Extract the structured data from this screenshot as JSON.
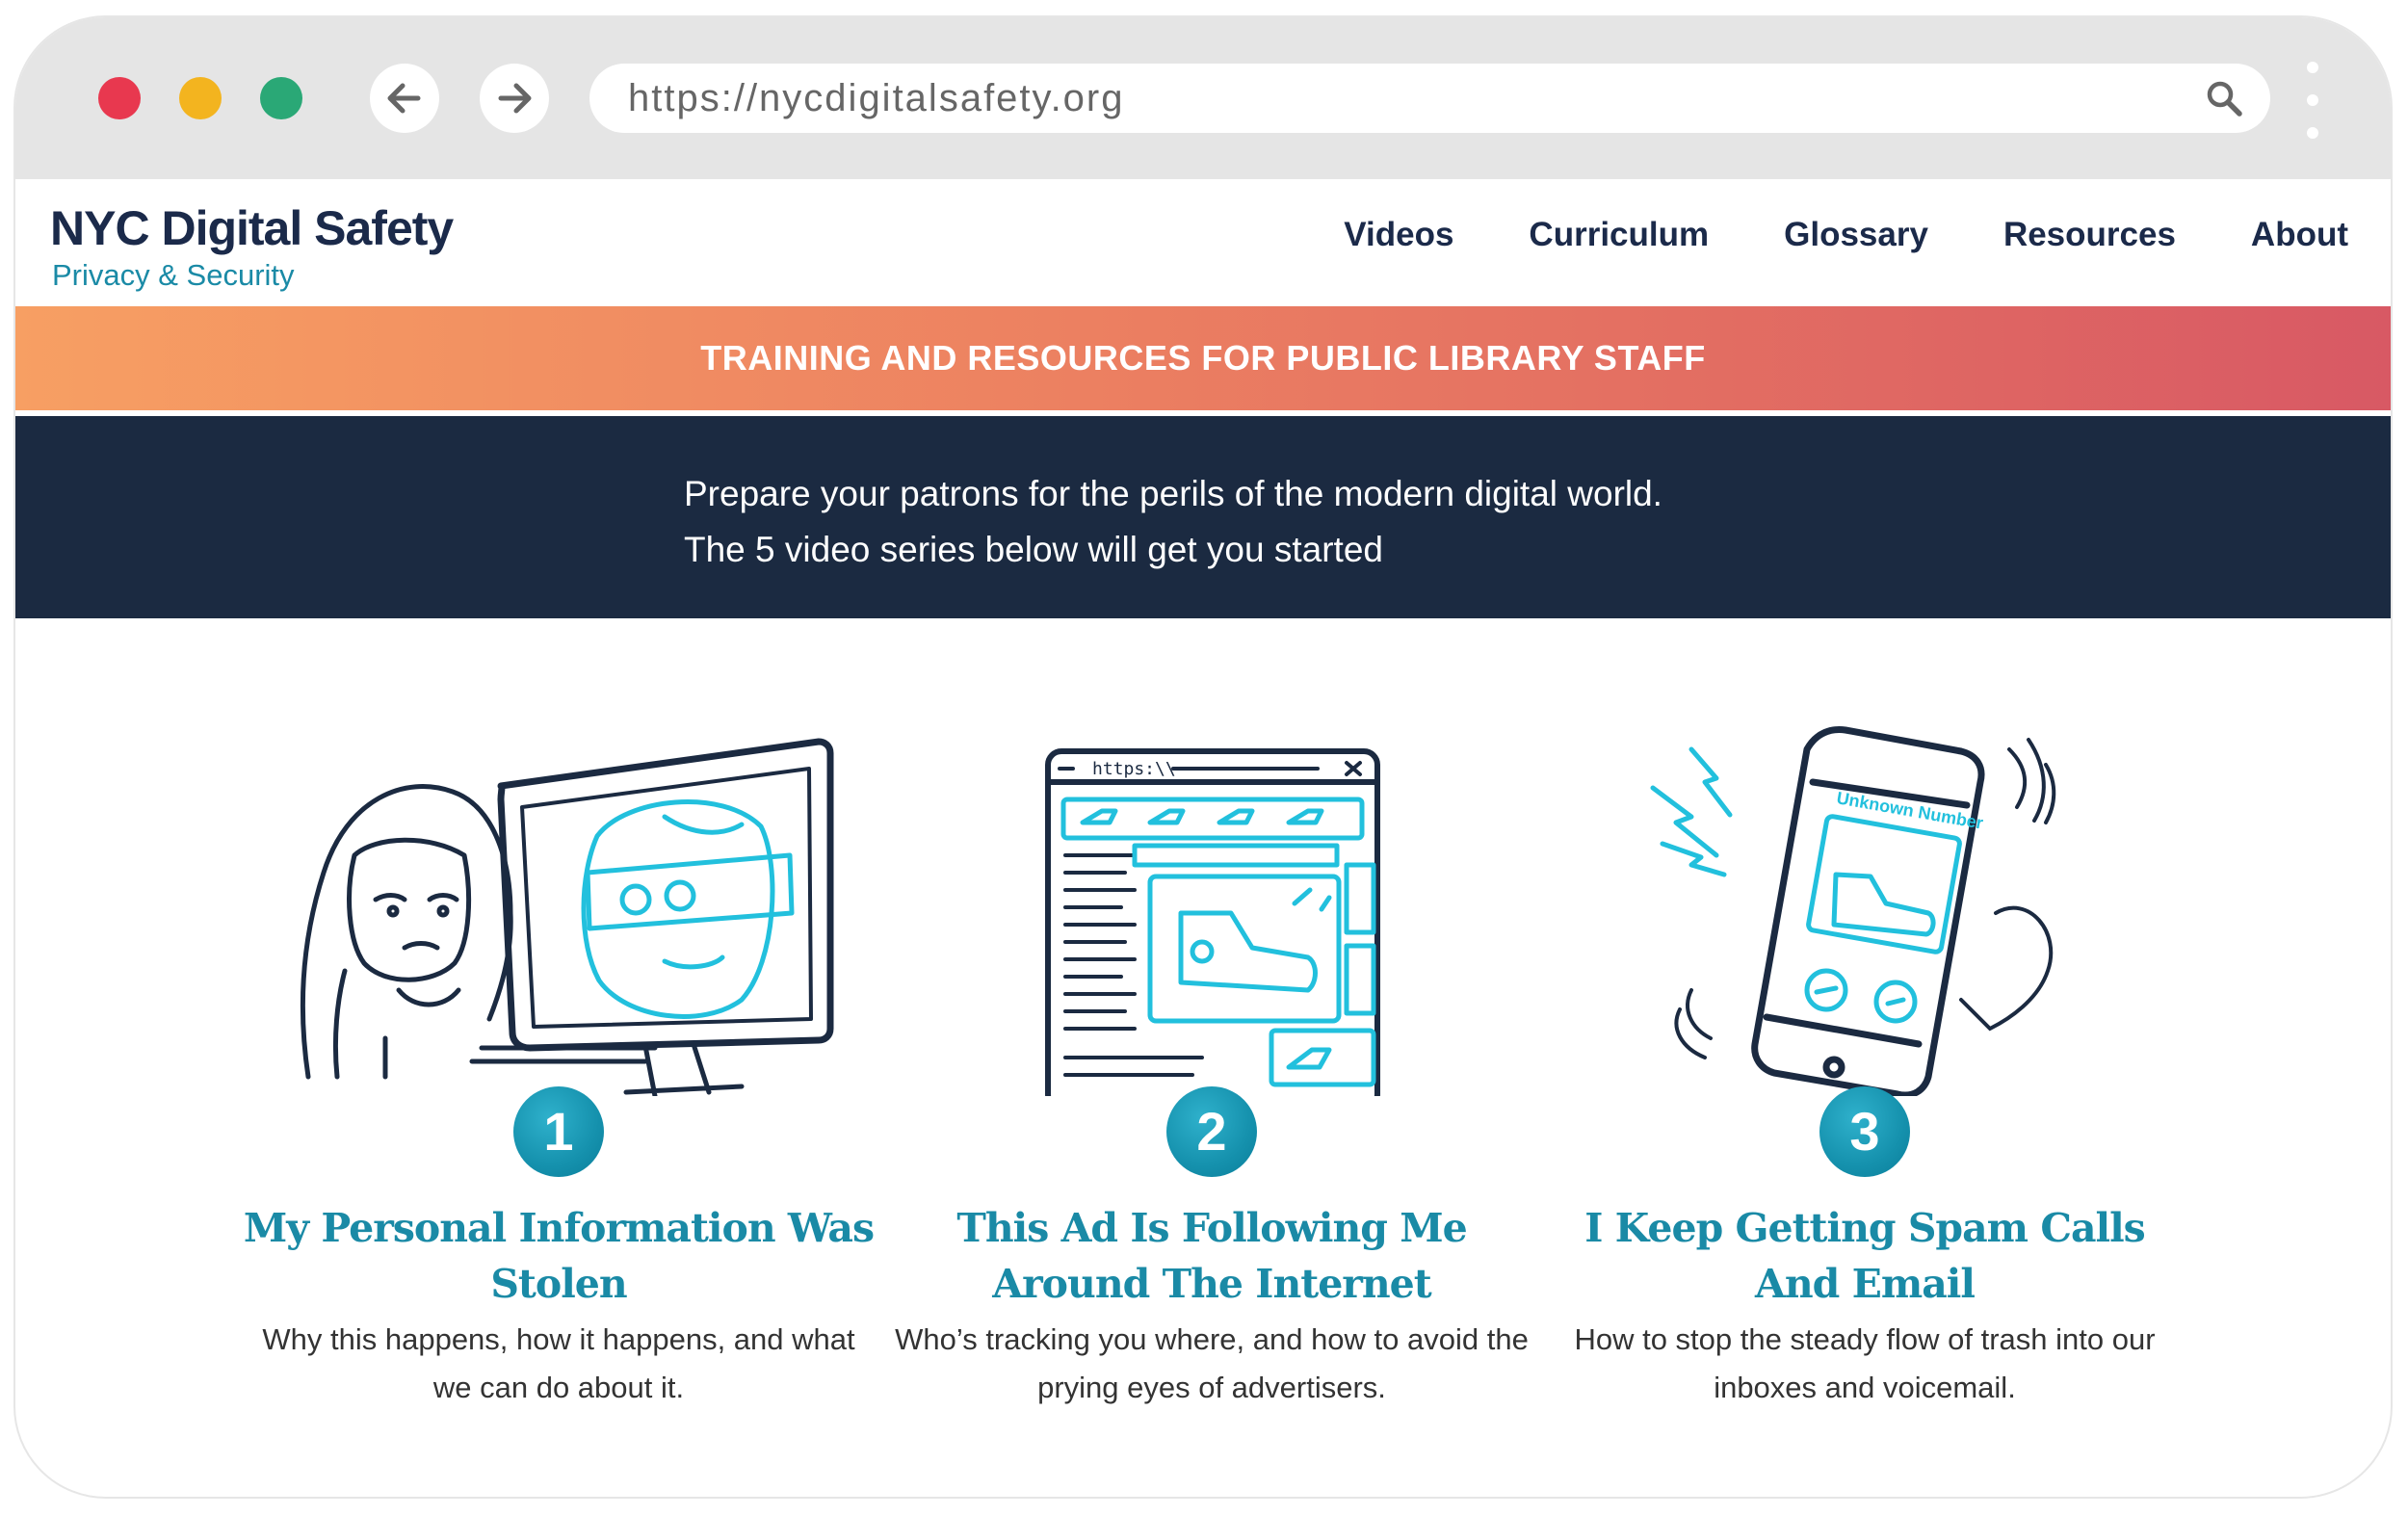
{
  "browser": {
    "url": "https://nycdigitalsafety.org"
  },
  "site": {
    "title": "NYC Digital Safety",
    "subtitle": "Privacy & Security"
  },
  "nav": {
    "items": [
      {
        "label": "Videos"
      },
      {
        "label": "Curriculum"
      },
      {
        "label": "Glossary"
      },
      {
        "label": "Resources"
      },
      {
        "label": "About"
      }
    ]
  },
  "banner": {
    "text": "TRAINING AND RESOURCES FOR PUBLIC LIBRARY STAFF"
  },
  "hero": {
    "line1": "Prepare your patrons for the perils of the modern digital world.",
    "line2": "The 5 video series below will get you started"
  },
  "cards": [
    {
      "number": "1",
      "title": "My Personal Information Was Stolen",
      "description": "Why this happens, how it happens, and what we can do about it."
    },
    {
      "number": "2",
      "title": "This Ad Is Following Me Around The Internet",
      "description": "Who’s tracking you where, and how to avoid the prying eyes of advertisers.",
      "illustration_url_text": "https:\\\\"
    },
    {
      "number": "3",
      "title": "I Keep Getting Spam Calls And Email",
      "description": "How to stop the steady flow of trash into our inboxes and voicemail.",
      "illustration_caller_text": "Unknown Number"
    }
  ],
  "colors": {
    "navy": "#1b2a41",
    "teal": "#1a8aa6",
    "cyan": "#22c0dd",
    "banner_start": "#f79f63",
    "banner_end": "#d85964",
    "traffic_red": "#e8384f",
    "traffic_yellow": "#f3b41f",
    "traffic_green": "#2aa876"
  }
}
